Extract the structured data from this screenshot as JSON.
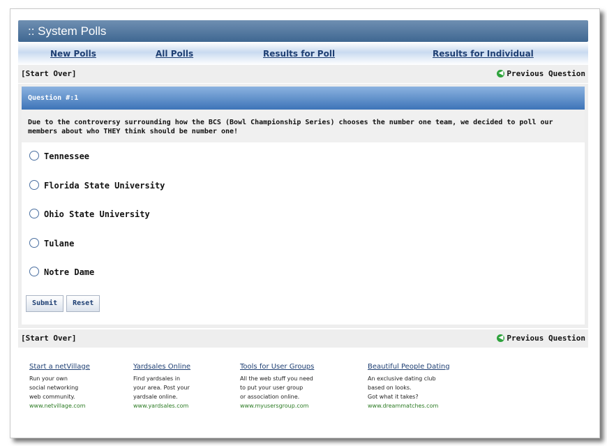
{
  "header": {
    "title": ":: System Polls"
  },
  "nav": [
    {
      "label": "New Polls"
    },
    {
      "label": "All Polls"
    },
    {
      "label": "Results for Poll"
    },
    {
      "label": "Results for Individual"
    }
  ],
  "controls": {
    "start_over": "[Start Over]",
    "previous": "Previous Question"
  },
  "question": {
    "header": "Question #:1",
    "text": "Due to the controversy surrounding how the BCS (Bowl Championship Series) chooses the number one team, we decided to poll our members about who THEY think should be number one!",
    "options": [
      "Tennessee",
      "Florida State University",
      "Ohio State University",
      "Tulane",
      "Notre Dame"
    ]
  },
  "buttons": {
    "submit": "Submit",
    "reset": "Reset"
  },
  "ads": [
    {
      "title": "Start a netVillage",
      "lines": [
        "Run your own",
        "social networking",
        "web community."
      ],
      "url": "www.netvillage.com"
    },
    {
      "title": "Yardsales Online",
      "lines": [
        "Find yardsales in",
        "your area. Post your",
        "yardsale online."
      ],
      "url": "www.yardsales.com"
    },
    {
      "title": "Tools for User Groups",
      "lines": [
        "All the web stuff you need",
        "to put your user group",
        "or association online."
      ],
      "url": "www.myusersgroup.com"
    },
    {
      "title": "Beautiful People Dating",
      "lines": [
        "An exclusive dating club",
        "based on looks.",
        "Got what it takes?"
      ],
      "url": "www.dreammatches.com"
    }
  ]
}
